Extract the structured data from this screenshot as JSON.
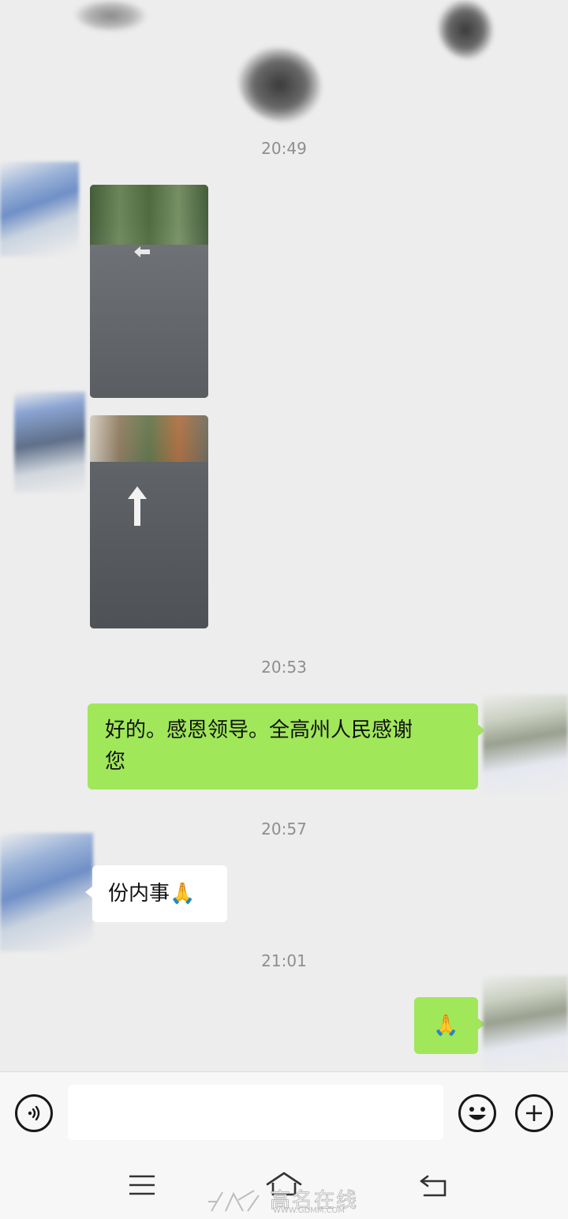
{
  "chat": {
    "messages": [
      {
        "type": "timestamp",
        "text": "20:49"
      },
      {
        "type": "image",
        "side": "in",
        "description_icon": "road-photo-icon"
      },
      {
        "type": "image",
        "side": "in",
        "description_icon": "road-arrow-photo-icon"
      },
      {
        "type": "timestamp",
        "text": "20:53"
      },
      {
        "type": "text",
        "side": "out",
        "line1": "好的。感恩领导。全高州人民感谢",
        "line2": "您"
      },
      {
        "type": "timestamp",
        "text": "20:57"
      },
      {
        "type": "text",
        "side": "in",
        "text": "份内事🙏"
      },
      {
        "type": "timestamp",
        "text": "21:01"
      },
      {
        "type": "text",
        "side": "out",
        "text": "🙏"
      }
    ]
  },
  "input_bar": {
    "voice_icon": "voice-icon",
    "emoji_icon": "emoji-icon",
    "plus_icon": "plus-icon",
    "text_value": ""
  },
  "nav_bar": {
    "menu_icon": "menu-icon",
    "home_icon": "home-icon",
    "back_icon": "back-icon"
  },
  "watermark": {
    "brand": "高名在线",
    "url": "WWW.GDMM.COM"
  },
  "colors": {
    "background": "#ededed",
    "outgoing_bubble": "#a0e75a",
    "incoming_bubble": "#ffffff",
    "timestamp": "#8e8e8e"
  }
}
